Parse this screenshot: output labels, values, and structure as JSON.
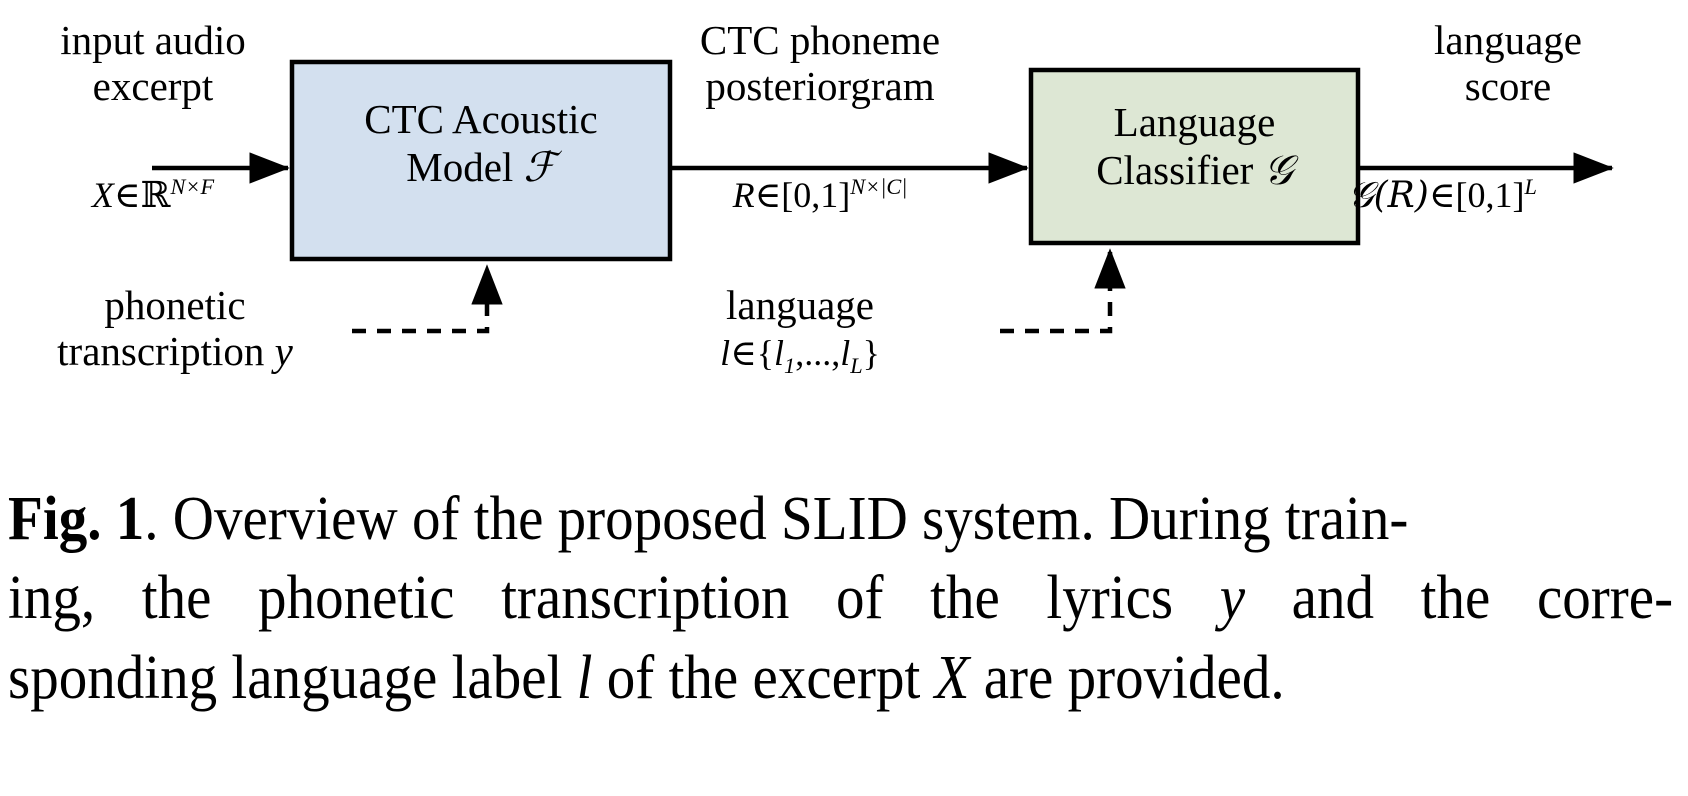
{
  "figure": {
    "type": "block-diagram",
    "colors": {
      "acoustic_model_fill": "#d3e0ef",
      "language_classifier_fill": "#dde7d4",
      "stroke": "#000000",
      "background": "#ffffff"
    },
    "blocks": [
      {
        "id": "acoustic-model",
        "line1": "CTC Acoustic",
        "line2_prefix": "Model ",
        "line2_symbol": "ℱ",
        "fill": "#d3e0ef"
      },
      {
        "id": "language-classifier",
        "line1": "Language",
        "line2_prefix": "Classifier ",
        "line2_symbol": "𝒢",
        "fill": "#dde7d4"
      }
    ],
    "input_label": {
      "line1": "input audio",
      "line2": "excerpt",
      "math_var": "X",
      "math_rel": "∈",
      "math_set": "ℝ",
      "math_exp": "N×F"
    },
    "middle_label": {
      "line1": "CTC phoneme",
      "line2": "posteriorgram",
      "math_var": "R",
      "math_rel": "∈",
      "math_set": "[0,1]",
      "math_exp": "N×|C|"
    },
    "output_label": {
      "line1": "language",
      "line2": "score",
      "math_fn": "𝒢(R)",
      "math_rel": "∈",
      "math_set": "[0,1]",
      "math_exp": "L"
    },
    "supervision_left": {
      "line1": "phonetic",
      "line2_prefix": "transcription ",
      "line2_symbol": "y",
      "arrow_style": "dashed"
    },
    "supervision_right": {
      "line1": "language",
      "line2_var": "l",
      "line2_rel": "∈",
      "line2_set_open": "{",
      "line2_set_item1": "l",
      "line2_set_sub1": "1",
      "line2_set_dots": ",...,",
      "line2_set_item2": "l",
      "line2_set_sub2": "L",
      "line2_set_close": "}",
      "arrow_style": "dashed"
    }
  },
  "caption": {
    "label": "Fig. 1",
    "label_suffix": ".",
    "line1_a": "Overview of the proposed SLID system. During train-",
    "line2_parts": [
      "ing,",
      "the",
      "phonetic",
      "transcription",
      "of",
      "the",
      "lyrics"
    ],
    "line2_var": "y",
    "line2_tail_parts": [
      "and",
      "the",
      "corre-"
    ],
    "line3_a": "sponding language label ",
    "line3_var1": "l",
    "line3_b": " of the excerpt ",
    "line3_var2": "X",
    "line3_c": " are provided.",
    "full_text": "Fig. 1. Overview of the proposed SLID system. During training, the phonetic transcription of the lyrics y and the corresponding language label l of the excerpt X are provided."
  }
}
